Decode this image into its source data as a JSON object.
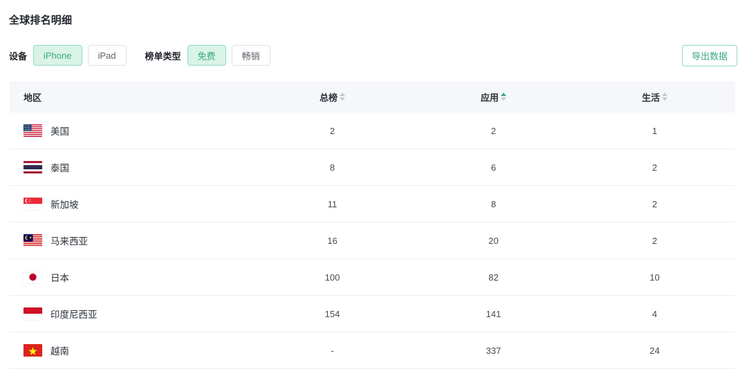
{
  "page": {
    "title": "全球排名明细"
  },
  "filters": {
    "device": {
      "label": "设备",
      "options": [
        {
          "label": "iPhone",
          "active": true
        },
        {
          "label": "iPad",
          "active": false
        }
      ]
    },
    "chart_type": {
      "label": "榜单类型",
      "options": [
        {
          "label": "免费",
          "active": true
        },
        {
          "label": "畅销",
          "active": false
        }
      ]
    }
  },
  "actions": {
    "export_label": "导出数据"
  },
  "table": {
    "columns": [
      {
        "key": "region",
        "label": "地区",
        "sortable": false,
        "sort": "none"
      },
      {
        "key": "overall",
        "label": "总榜",
        "sortable": true,
        "sort": "none"
      },
      {
        "key": "apps",
        "label": "应用",
        "sortable": true,
        "sort": "asc"
      },
      {
        "key": "lifestyle",
        "label": "生活",
        "sortable": true,
        "sort": "none"
      }
    ],
    "rows": [
      {
        "flag": "flag-us-icon",
        "region": "美国",
        "overall": "2",
        "apps": "2",
        "lifestyle": "1"
      },
      {
        "flag": "flag-th-icon",
        "region": "泰国",
        "overall": "8",
        "apps": "6",
        "lifestyle": "2"
      },
      {
        "flag": "flag-sg-icon",
        "region": "新加坡",
        "overall": "11",
        "apps": "8",
        "lifestyle": "2"
      },
      {
        "flag": "flag-my-icon",
        "region": "马来西亚",
        "overall": "16",
        "apps": "20",
        "lifestyle": "2"
      },
      {
        "flag": "flag-jp-icon",
        "region": "日本",
        "overall": "100",
        "apps": "82",
        "lifestyle": "10"
      },
      {
        "flag": "flag-id-icon",
        "region": "印度尼西亚",
        "overall": "154",
        "apps": "141",
        "lifestyle": "4"
      },
      {
        "flag": "flag-vn-icon",
        "region": "越南",
        "overall": "-",
        "apps": "337",
        "lifestyle": "24"
      }
    ]
  },
  "colors": {
    "accent": "#3ba97c",
    "accent_bg": "#d9f3e8",
    "accent_border": "#8fd9bd",
    "header_bg": "#f5f7fa",
    "row_border": "#ebeef3",
    "text": "#2b3139"
  }
}
